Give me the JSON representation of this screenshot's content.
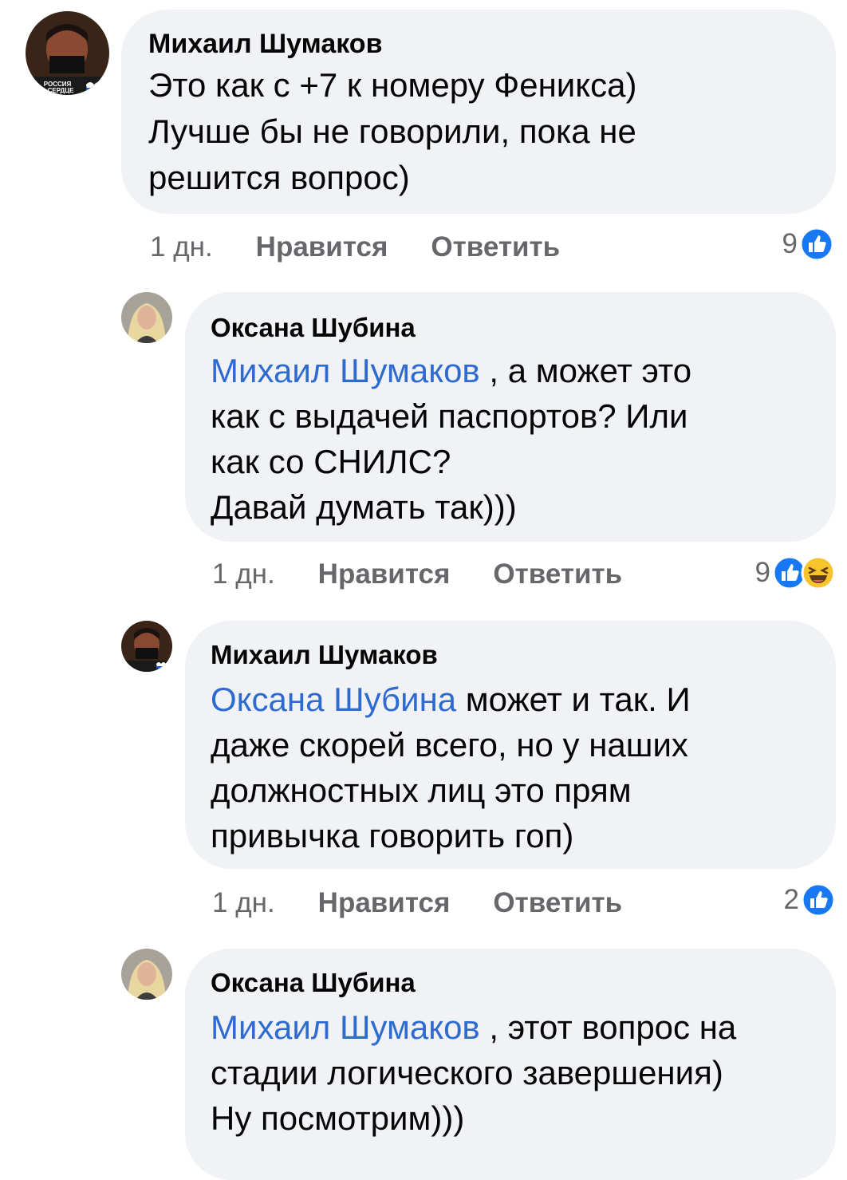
{
  "comments": [
    {
      "author": "Михаил Шумаков",
      "mention": "",
      "text": "Это как с +7 к номеру Феникса)\nЛучше бы не говорили, пока не\nрешится вопрос)",
      "time": "1 дн.",
      "like_label": "Нравится",
      "reply_label": "Ответить",
      "reactions_count": "9",
      "reactions": [
        "like-icon"
      ],
      "avatar_caption": "РОССИЯ В СЕРДЦЕ"
    },
    {
      "author": "Оксана Шубина",
      "mention": "Михаил Шумаков",
      "text": " , а может это\nкак с выдачей паспортов? Или\nкак со СНИЛС?\nДавай думать так)))",
      "time": "1 дн.",
      "like_label": "Нравится",
      "reply_label": "Ответить",
      "reactions_count": "9",
      "reactions": [
        "like-icon",
        "haha-icon"
      ]
    },
    {
      "author": "Михаил Шумаков",
      "mention": "Оксана Шубина",
      "text": " может и так. И\nдаже скорей всего, но у наших\nдолжностных лиц это прям\nпривычка говорить гоп)",
      "time": "1 дн.",
      "like_label": "Нравится",
      "reply_label": "Ответить",
      "reactions_count": "2",
      "reactions": [
        "like-icon"
      ]
    },
    {
      "author": "Оксана Шубина",
      "mention": "Михаил Шумаков",
      "text": " , этот вопрос на\nстадии логического завершения)\nНу посмотрим)))"
    }
  ],
  "colors": {
    "bubble": "#f0f2f5",
    "mention": "#2e6bd1",
    "meta": "#65676b",
    "like_blue": "#1877f2",
    "haha_yellow": "#f7c42d"
  }
}
